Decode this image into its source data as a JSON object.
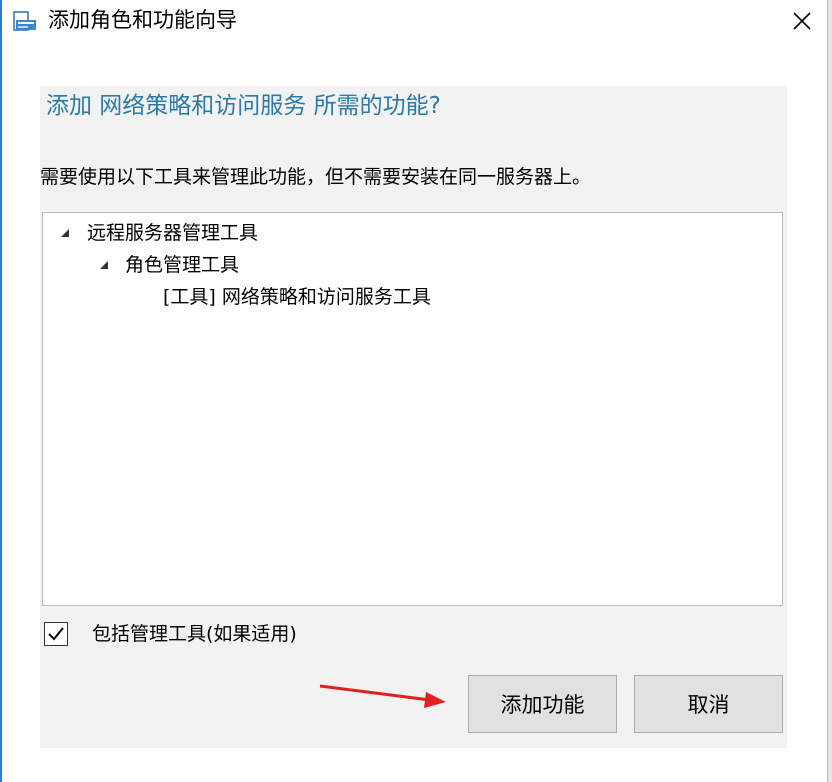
{
  "window": {
    "title": "添加角色和功能向导"
  },
  "dialog": {
    "heading": "添加 网络策略和访问服务 所需的功能?",
    "description": "需要使用以下工具来管理此功能，但不需要安装在同一服务器上。",
    "tree": [
      {
        "label": "远程服务器管理工具",
        "level": 0,
        "expanded": true
      },
      {
        "label": "角色管理工具",
        "level": 1,
        "expanded": true
      },
      {
        "label": "[工具] 网络策略和访问服务工具",
        "level": 2,
        "expanded": null
      }
    ],
    "include_tools": {
      "label": "包括管理工具(如果适用)",
      "checked": true
    },
    "buttons": {
      "add": "添加功能",
      "cancel": "取消"
    }
  },
  "colors": {
    "heading": "#2b79a8",
    "annotation_arrow": "#e02020",
    "panel_background": "#f2f2f2"
  },
  "icons": [
    "app-wizard-icon",
    "close-icon",
    "expand-arrow-icon",
    "checkmark-icon",
    "annotation-arrow-icon"
  ]
}
